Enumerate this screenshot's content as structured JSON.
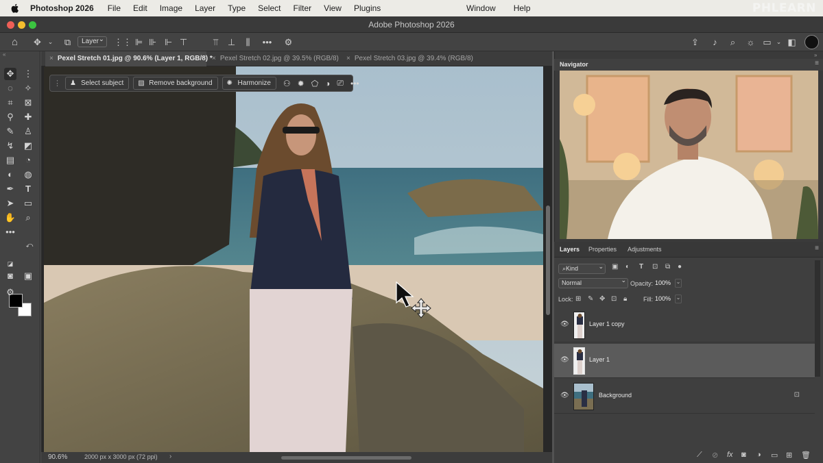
{
  "menubar": {
    "app": "Photoshop 2026",
    "items": [
      "File",
      "Edit",
      "Image",
      "Layer",
      "Type",
      "Select",
      "Filter",
      "View",
      "Plugins"
    ],
    "right_items": [
      "Window",
      "Help"
    ],
    "brand": "PHLEARN"
  },
  "window": {
    "title": "Adobe Photoshop 2026"
  },
  "options": {
    "auto_select_target": "Layer"
  },
  "tabs": [
    {
      "label": "Pexel Stretch 01.jpg @ 90.6% (Layer 1, RGB/8) *",
      "active": true
    },
    {
      "label": "Pexel Stretch 02.jpg @ 39.5% (RGB/8)",
      "active": false
    },
    {
      "label": "Pexel Stretch 03.jpg @ 39.4% (RGB/8)",
      "active": false
    }
  ],
  "context_bar": {
    "select_subject": "Select subject",
    "remove_background": "Remove background",
    "harmonize": "Harmonize"
  },
  "status": {
    "zoom": "90.6%",
    "dimensions": "2000 px x 3000 px (72 ppi)"
  },
  "navigator": {
    "title": "Navigator"
  },
  "layers_panel": {
    "tabs": [
      "Layers",
      "Properties",
      "Adjustments"
    ],
    "filter": "Kind",
    "blend_mode": "Normal",
    "opacity_label": "Opacity:",
    "opacity": "100%",
    "lock_label": "Lock:",
    "fill_label": "Fill:",
    "fill": "100%",
    "layers": [
      {
        "name": "Layer 1 copy",
        "selected": false
      },
      {
        "name": "Layer 1",
        "selected": true
      },
      {
        "name": "Background",
        "selected": false,
        "locked": true
      }
    ]
  },
  "colors": {
    "accent": "#4a4a4a",
    "panel": "#3f3f3f",
    "selected_row": "#5b5b5b"
  }
}
